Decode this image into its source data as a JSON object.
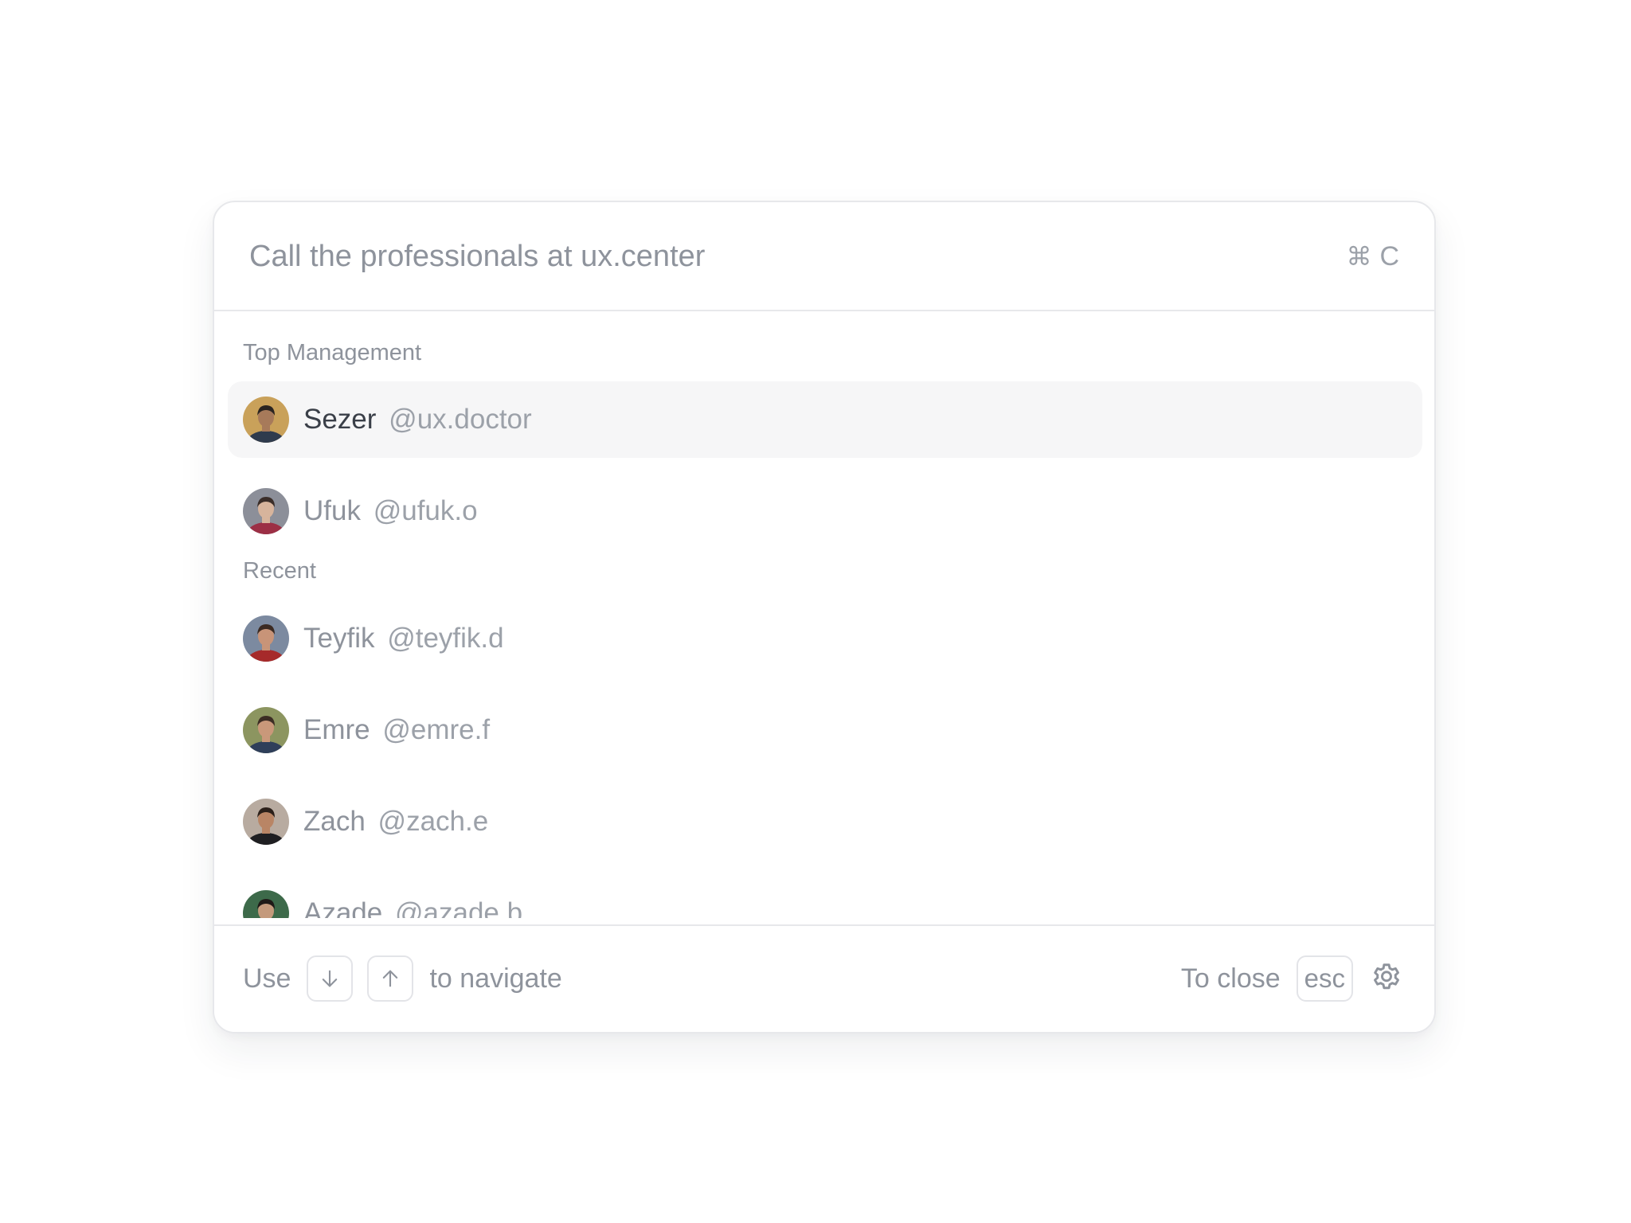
{
  "search": {
    "placeholder": "Call the professionals at ux.center",
    "shortcut_symbol": "⌘",
    "shortcut_key": "C",
    "shortcut_icon": "command-icon"
  },
  "sections": [
    {
      "label": "Top Management",
      "people": [
        {
          "name": "Sezer",
          "handle": "@ux.doctor",
          "active": true,
          "avatar_colors": [
            "#c9a15a",
            "#2f3b4d",
            "#a77a5a",
            "#2a2420"
          ]
        },
        {
          "name": "Ufuk",
          "handle": "@ufuk.o",
          "active": false,
          "avatar_colors": [
            "#8c8f99",
            "#9c2f45",
            "#d7b49c",
            "#3a2d28"
          ]
        }
      ]
    },
    {
      "label": "Recent",
      "people": [
        {
          "name": "Teyfik",
          "handle": "@teyfik.d",
          "active": false,
          "avatar_colors": [
            "#7c8aa0",
            "#a62a2a",
            "#c89478",
            "#3b2a22"
          ]
        },
        {
          "name": "Emre",
          "handle": "@emre.f",
          "active": false,
          "avatar_colors": [
            "#8c9560",
            "#2f3f5a",
            "#c9987a",
            "#3c2d24"
          ]
        },
        {
          "name": "Zach",
          "handle": "@zach.e",
          "active": false,
          "avatar_colors": [
            "#b8aba0",
            "#1f1f22",
            "#b98565",
            "#2b201a"
          ]
        },
        {
          "name": "Azade",
          "handle": "@azade.b",
          "active": false,
          "avatar_colors": [
            "#3d6a4a",
            "#2c3440",
            "#c49a7c",
            "#1f1a17"
          ]
        }
      ]
    }
  ],
  "footer": {
    "use_label": "Use",
    "down_key_icon": "arrow-down-icon",
    "up_key_icon": "arrow-up-icon",
    "navigate_label": "to navigate",
    "close_label": "To close",
    "esc_key": "esc",
    "settings_icon": "gear-icon"
  },
  "colors": {
    "border": "#e7e8eb",
    "active_row_bg": "#f6f6f7",
    "muted_text": "#8e939c",
    "strong_text": "#3a3f48"
  }
}
